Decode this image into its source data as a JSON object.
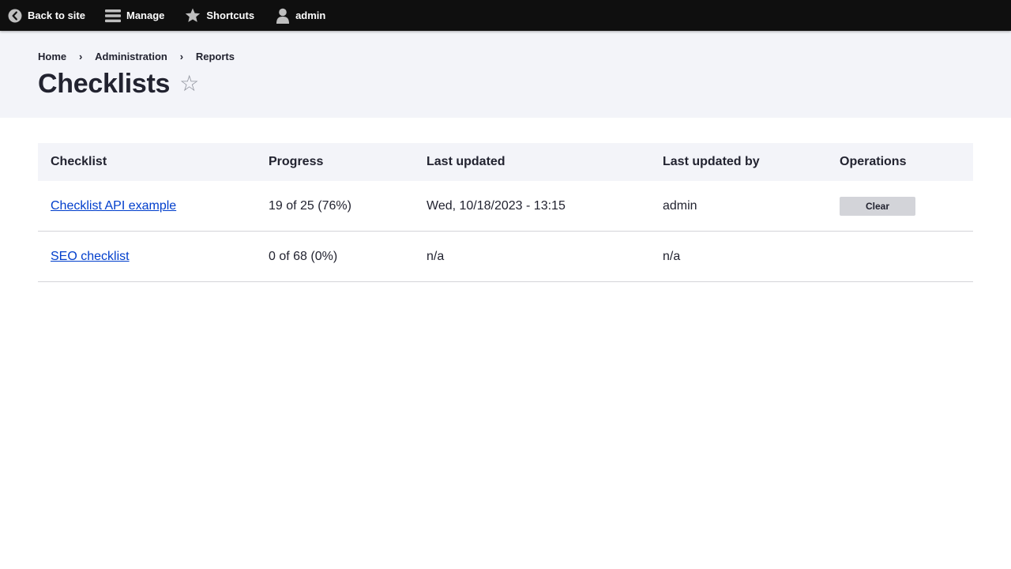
{
  "toolbar": {
    "back_label": "Back to site",
    "manage_label": "Manage",
    "shortcuts_label": "Shortcuts",
    "user_label": "admin",
    "icons": {
      "back": "chevron-left-circle-icon",
      "manage": "hamburger-menu-icon",
      "shortcuts": "star-icon",
      "user": "user-icon"
    }
  },
  "breadcrumb": {
    "items": [
      "Home",
      "Administration",
      "Reports"
    ],
    "separator": "›"
  },
  "page": {
    "title": "Checklists",
    "star_glyph": "☆"
  },
  "table": {
    "headers": [
      "Checklist",
      "Progress",
      "Last updated",
      "Last updated by",
      "Operations"
    ],
    "rows": [
      {
        "checklist": "Checklist API example",
        "progress": "19 of 25 (76%)",
        "last_updated": "Wed, 10/18/2023 - 13:15",
        "last_updated_by": "admin",
        "operation": "Clear"
      },
      {
        "checklist": "SEO checklist",
        "progress": "0 of 68 (0%)",
        "last_updated": "n/a",
        "last_updated_by": "n/a",
        "operation": ""
      }
    ]
  },
  "colors": {
    "toolbar_bg": "#0f0f0f",
    "header_bg": "#f3f4f9",
    "link": "#003ecc",
    "button_bg": "#d3d4d9"
  }
}
